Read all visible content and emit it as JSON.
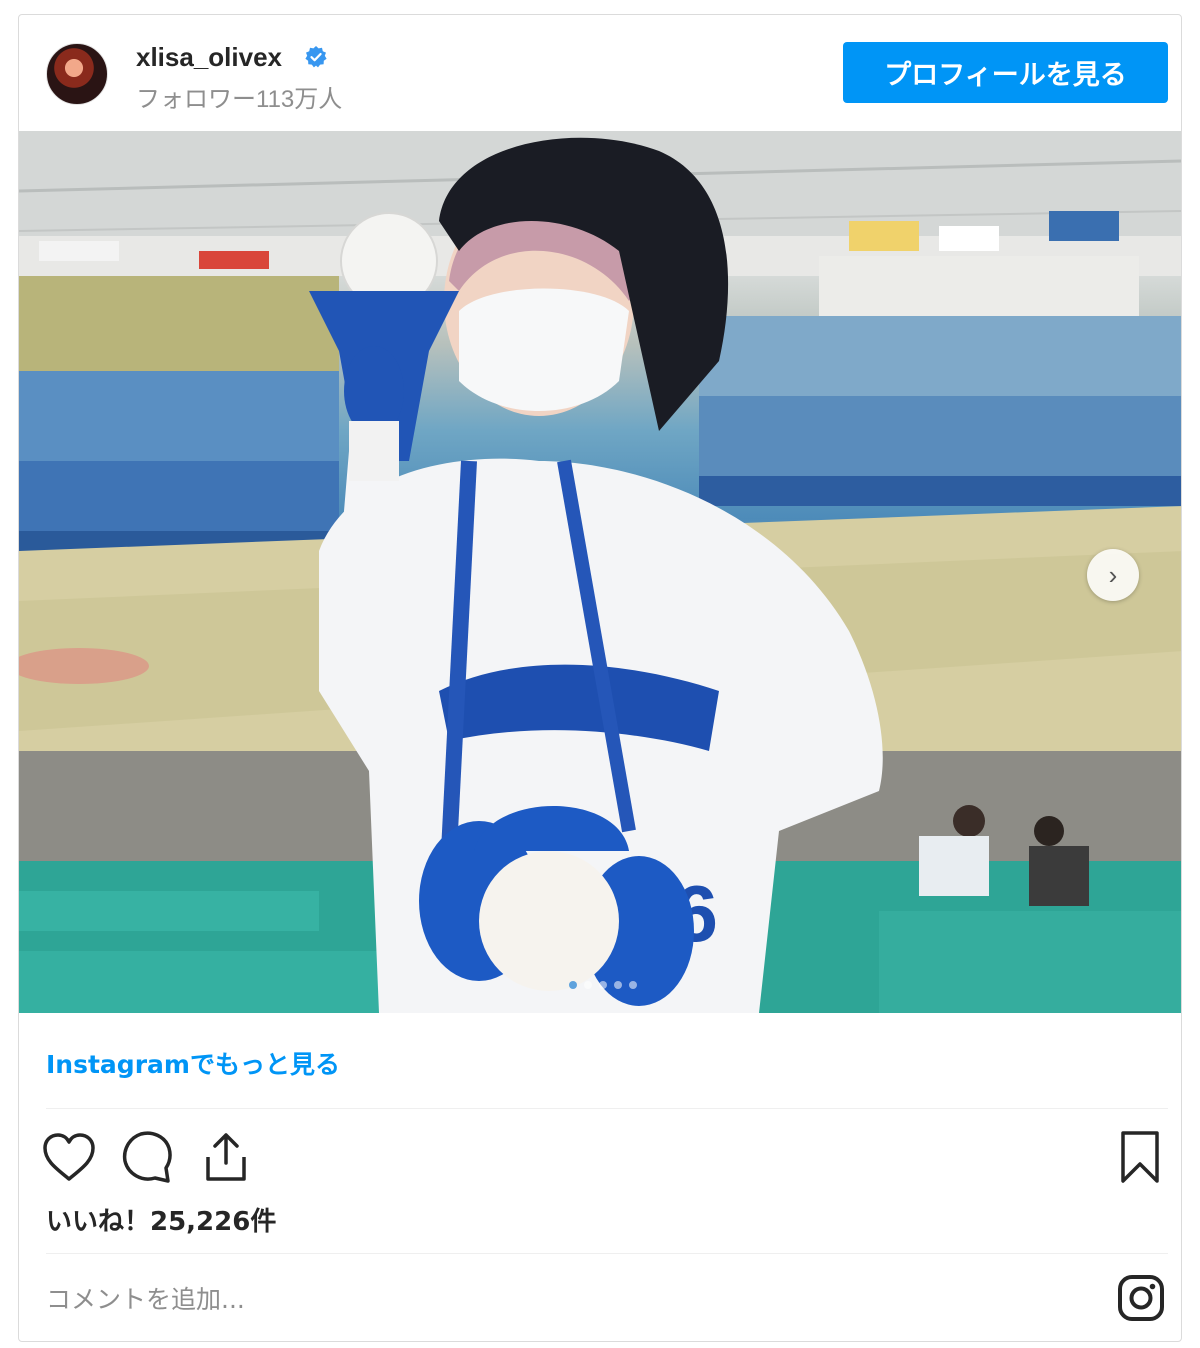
{
  "header": {
    "username": "xlisa_olivex",
    "followers": "フォロワー113万人",
    "profile_button": "プロフィールを見る"
  },
  "photo": {
    "pagination": {
      "current": 1,
      "total": 5
    }
  },
  "footer": {
    "more_link": "Instagramでもっと見る",
    "likes": "いいね！25,226件",
    "comment_placeholder": "コメントを追加..."
  },
  "colors": {
    "accent": "#0095f6",
    "text": "#262626",
    "muted": "#8e8e8e",
    "border": "#dbdbdb"
  },
  "icons": [
    "verified-badge-icon",
    "heart-icon",
    "comment-icon",
    "share-icon",
    "bookmark-icon",
    "instagram-icon",
    "chevron-right-icon"
  ]
}
